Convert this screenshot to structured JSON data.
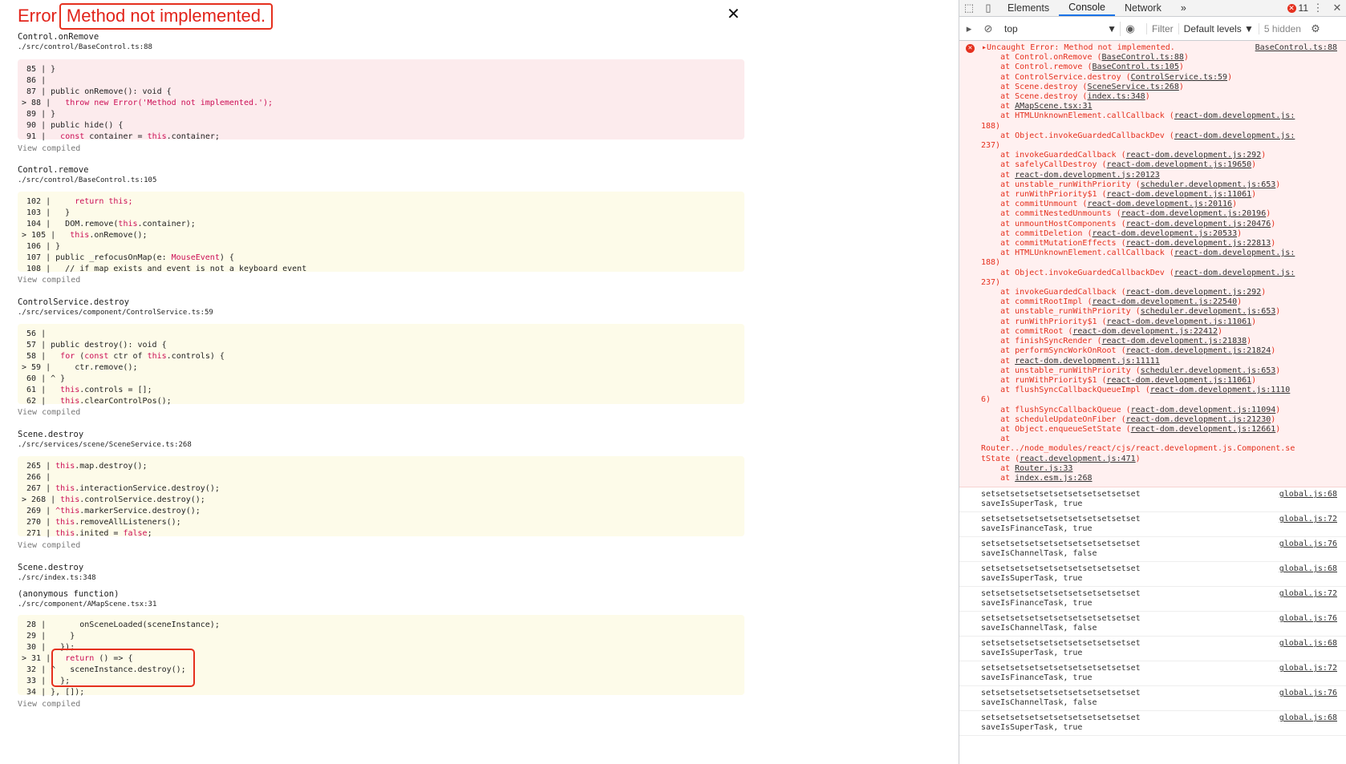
{
  "error": {
    "title": "Error",
    "message": "Method not implemented."
  },
  "frames": [
    {
      "fn": "Control.onRemove",
      "file": "./src/control/BaseControl.ts:88",
      "variant": "pink",
      "lines": [
        [
          {
            "t": " 85 | }"
          }
        ],
        [
          {
            "t": " 86 |"
          }
        ],
        [
          {
            "t": " 87 | public onRemove(): void {"
          }
        ],
        [
          {
            "t": "> 88 |   "
          },
          {
            "t": "throw new Error('Method not implemented.');",
            "c": "kw"
          }
        ],
        [
          {
            "t": " 89 | }"
          }
        ],
        [
          {
            "t": " 90 | public hide() {"
          }
        ],
        [
          {
            "t": " 91 |   "
          },
          {
            "t": "const",
            "c": "kw"
          },
          {
            "t": " container = "
          },
          {
            "t": "this",
            "c": "kw"
          },
          {
            "t": ".container;"
          }
        ]
      ],
      "view_compiled": "View compiled"
    },
    {
      "fn": "Control.remove",
      "file": "./src/control/BaseControl.ts:105",
      "variant": "yellow",
      "lines": [
        [
          {
            "t": " 102 |     "
          },
          {
            "t": "return this;",
            "c": "kw"
          }
        ],
        [
          {
            "t": " 103 |   }"
          }
        ],
        [
          {
            "t": " 104 |   DOM.remove("
          },
          {
            "t": "this",
            "c": "kw"
          },
          {
            "t": ".container);"
          }
        ],
        [
          {
            "t": "> 105 |   "
          },
          {
            "t": "this",
            "c": "kw"
          },
          {
            "t": ".onRemove();"
          }
        ],
        [
          {
            "t": " 106 | }"
          }
        ],
        [
          {
            "t": " 107 | public _refocusOnMap(e: "
          },
          {
            "t": "MouseEvent",
            "c": "kw"
          },
          {
            "t": ") {"
          }
        ],
        [
          {
            "t": " 108 |   // if map exists and event is not a keyboard event"
          }
        ]
      ],
      "view_compiled": "View compiled"
    },
    {
      "fn": "ControlService.destroy",
      "file": "./src/services/component/ControlService.ts:59",
      "variant": "yellow",
      "lines": [
        [
          {
            "t": " 56 |"
          }
        ],
        [
          {
            "t": " 57 | public destroy(): void {"
          }
        ],
        [
          {
            "t": " 58 |   "
          },
          {
            "t": "for",
            "c": "kw"
          },
          {
            "t": " ("
          },
          {
            "t": "const",
            "c": "kw"
          },
          {
            "t": " ctr of "
          },
          {
            "t": "this",
            "c": "kw"
          },
          {
            "t": ".controls) {"
          }
        ],
        [
          {
            "t": "> 59 |     ctr.remove();"
          }
        ],
        [
          {
            "t": " 60 | ^ }"
          }
        ],
        [
          {
            "t": " 61 |   "
          },
          {
            "t": "this",
            "c": "kw"
          },
          {
            "t": ".controls = [];"
          }
        ],
        [
          {
            "t": " 62 |   "
          },
          {
            "t": "this",
            "c": "kw"
          },
          {
            "t": ".clearControlPos();"
          }
        ]
      ],
      "view_compiled": "View compiled"
    },
    {
      "fn": "Scene.destroy",
      "file": "./src/services/scene/SceneService.ts:268",
      "variant": "yellow",
      "lines": [
        [
          {
            "t": " 265 | "
          },
          {
            "t": "this",
            "c": "kw"
          },
          {
            "t": ".map.destroy();"
          }
        ],
        [
          {
            "t": " 266 |"
          }
        ],
        [
          {
            "t": " 267 | "
          },
          {
            "t": "this",
            "c": "kw"
          },
          {
            "t": ".interactionService.destroy();"
          }
        ],
        [
          {
            "t": "> 268 | "
          },
          {
            "t": "this",
            "c": "kw"
          },
          {
            "t": ".controlService.destroy();"
          }
        ],
        [
          {
            "t": " 269 | "
          },
          {
            "t": "^this",
            "c": "kw"
          },
          {
            "t": ".markerService.destroy();"
          }
        ],
        [
          {
            "t": " 270 | "
          },
          {
            "t": "this",
            "c": "kw"
          },
          {
            "t": ".removeAllListeners();"
          }
        ],
        [
          {
            "t": " 271 | "
          },
          {
            "t": "this",
            "c": "kw"
          },
          {
            "t": ".inited = "
          },
          {
            "t": "false",
            "c": "kw"
          },
          {
            "t": ";"
          }
        ]
      ],
      "view_compiled": "View compiled"
    },
    {
      "fn": "Scene.destroy",
      "file": "./src/index.ts:348",
      "lines": []
    },
    {
      "fn": "(anonymous function)",
      "file": "./src/component/AMapScene.tsx:31",
      "variant": "yellow",
      "lines": [
        [
          {
            "t": " 28 |       onSceneLoaded(sceneInstance);"
          }
        ],
        [
          {
            "t": " 29 |     }"
          }
        ],
        [
          {
            "t": " 30 |   });"
          }
        ],
        [
          {
            "t": "> 31 |   "
          },
          {
            "t": "return",
            "c": "kw"
          },
          {
            "t": " () => {"
          }
        ],
        [
          {
            "t": " 32 | ^   sceneInstance.destroy();"
          }
        ],
        [
          {
            "t": " 33 |   };"
          }
        ],
        [
          {
            "t": " 34 | }, []);"
          }
        ]
      ],
      "view_compiled": "View compiled"
    }
  ],
  "devtools": {
    "tabs": [
      "Elements",
      "Console",
      "Network"
    ],
    "active_tab": "Console",
    "more": "»",
    "error_count": "11",
    "context": "top",
    "filter_placeholder": "Filter",
    "levels": "Default levels ▼",
    "hidden": "5 hidden",
    "uncaught": {
      "message": "Uncaught Error: Method not implemented.",
      "source": "BaseControl.ts:88",
      "stack": [
        {
          "pre": "    at Control.onRemove (",
          "link": "BaseControl.ts:88",
          "post": ")"
        },
        {
          "pre": "    at Control.remove (",
          "link": "BaseControl.ts:105",
          "post": ")"
        },
        {
          "pre": "    at ControlService.destroy (",
          "link": "ControlService.ts:59",
          "post": ")"
        },
        {
          "pre": "    at Scene.destroy (",
          "link": "SceneService.ts:268",
          "post": ")"
        },
        {
          "pre": "    at Scene.destroy (",
          "link": "index.ts:348",
          "post": ")"
        },
        {
          "pre": "    at ",
          "link": "AMapScene.tsx:31",
          "post": ""
        },
        {
          "pre": "    at HTMLUnknownElement.callCallback (",
          "link": "react-dom.development.js:",
          "post": ""
        },
        {
          "pre": "188)",
          "link": "",
          "post": ""
        },
        {
          "pre": "    at Object.invokeGuardedCallbackDev (",
          "link": "react-dom.development.js:",
          "post": ""
        },
        {
          "pre": "237)",
          "link": "",
          "post": ""
        },
        {
          "pre": "    at invokeGuardedCallback (",
          "link": "react-dom.development.js:292",
          "post": ")"
        },
        {
          "pre": "    at safelyCallDestroy (",
          "link": "react-dom.development.js:19650",
          "post": ")"
        },
        {
          "pre": "    at ",
          "link": "react-dom.development.js:20123",
          "post": ""
        },
        {
          "pre": "    at unstable_runWithPriority (",
          "link": "scheduler.development.js:653",
          "post": ")"
        },
        {
          "pre": "    at runWithPriority$1 (",
          "link": "react-dom.development.js:11061",
          "post": ")"
        },
        {
          "pre": "    at commitUnmount (",
          "link": "react-dom.development.js:20116",
          "post": ")"
        },
        {
          "pre": "    at commitNestedUnmounts (",
          "link": "react-dom.development.js:20196",
          "post": ")"
        },
        {
          "pre": "    at unmountHostComponents (",
          "link": "react-dom.development.js:20476",
          "post": ")"
        },
        {
          "pre": "    at commitDeletion (",
          "link": "react-dom.development.js:20533",
          "post": ")"
        },
        {
          "pre": "    at commitMutationEffects (",
          "link": "react-dom.development.js:22813",
          "post": ")"
        },
        {
          "pre": "    at HTMLUnknownElement.callCallback (",
          "link": "react-dom.development.js:",
          "post": ""
        },
        {
          "pre": "188)",
          "link": "",
          "post": ""
        },
        {
          "pre": "    at Object.invokeGuardedCallbackDev (",
          "link": "react-dom.development.js:",
          "post": ""
        },
        {
          "pre": "237)",
          "link": "",
          "post": ""
        },
        {
          "pre": "    at invokeGuardedCallback (",
          "link": "react-dom.development.js:292",
          "post": ")"
        },
        {
          "pre": "    at commitRootImpl (",
          "link": "react-dom.development.js:22540",
          "post": ")"
        },
        {
          "pre": "    at unstable_runWithPriority (",
          "link": "scheduler.development.js:653",
          "post": ")"
        },
        {
          "pre": "    at runWithPriority$1 (",
          "link": "react-dom.development.js:11061",
          "post": ")"
        },
        {
          "pre": "    at commitRoot (",
          "link": "react-dom.development.js:22412",
          "post": ")"
        },
        {
          "pre": "    at finishSyncRender (",
          "link": "react-dom.development.js:21838",
          "post": ")"
        },
        {
          "pre": "    at performSyncWorkOnRoot (",
          "link": "react-dom.development.js:21824",
          "post": ")"
        },
        {
          "pre": "    at ",
          "link": "react-dom.development.js:11111",
          "post": ""
        },
        {
          "pre": "    at unstable_runWithPriority (",
          "link": "scheduler.development.js:653",
          "post": ")"
        },
        {
          "pre": "    at runWithPriority$1 (",
          "link": "react-dom.development.js:11061",
          "post": ")"
        },
        {
          "pre": "    at flushSyncCallbackQueueImpl (",
          "link": "react-dom.development.js:1110",
          "post": ""
        },
        {
          "pre": "6)",
          "link": "",
          "post": ""
        },
        {
          "pre": "    at flushSyncCallbackQueue (",
          "link": "react-dom.development.js:11094",
          "post": ")"
        },
        {
          "pre": "    at scheduleUpdateOnFiber (",
          "link": "react-dom.development.js:21230",
          "post": ")"
        },
        {
          "pre": "    at Object.enqueueSetState (",
          "link": "react-dom.development.js:12661",
          "post": ")"
        },
        {
          "pre": "    at",
          "link": "",
          "post": ""
        },
        {
          "pre": "Router../node_modules/react/cjs/react.development.js.Component.se",
          "link": "",
          "post": ""
        },
        {
          "pre": "tState (",
          "link": "react.development.js:471",
          "post": ")"
        },
        {
          "pre": "    at ",
          "link": "Router.js:33",
          "post": ""
        },
        {
          "pre": "    at ",
          "link": "index.esm.js:268",
          "post": ""
        }
      ]
    },
    "logs": [
      {
        "line1": "setsetsetsetsetsetsetsetsetsetset",
        "line2": "saveIsSuperTask, true",
        "src": "global.js:68"
      },
      {
        "line1": "setsetsetsetsetsetsetsetsetsetset",
        "line2": "saveIsFinanceTask, true",
        "src": "global.js:72"
      },
      {
        "line1": "setsetsetsetsetsetsetsetsetsetset",
        "line2": "saveIsChannelTask, false",
        "src": "global.js:76"
      },
      {
        "line1": "setsetsetsetsetsetsetsetsetsetset",
        "line2": "saveIsSuperTask, true",
        "src": "global.js:68"
      },
      {
        "line1": "setsetsetsetsetsetsetsetsetsetset",
        "line2": "saveIsFinanceTask, true",
        "src": "global.js:72"
      },
      {
        "line1": "setsetsetsetsetsetsetsetsetsetset",
        "line2": "saveIsChannelTask, false",
        "src": "global.js:76"
      },
      {
        "line1": "setsetsetsetsetsetsetsetsetsetset",
        "line2": "saveIsSuperTask, true",
        "src": "global.js:68"
      },
      {
        "line1": "setsetsetsetsetsetsetsetsetsetset",
        "line2": "saveIsFinanceTask, true",
        "src": "global.js:72"
      },
      {
        "line1": "setsetsetsetsetsetsetsetsetsetset",
        "line2": "saveIsChannelTask, false",
        "src": "global.js:76"
      },
      {
        "line1": "setsetsetsetsetsetsetsetsetsetset",
        "line2": "saveIsSuperTask, true",
        "src": "global.js:68"
      }
    ]
  }
}
